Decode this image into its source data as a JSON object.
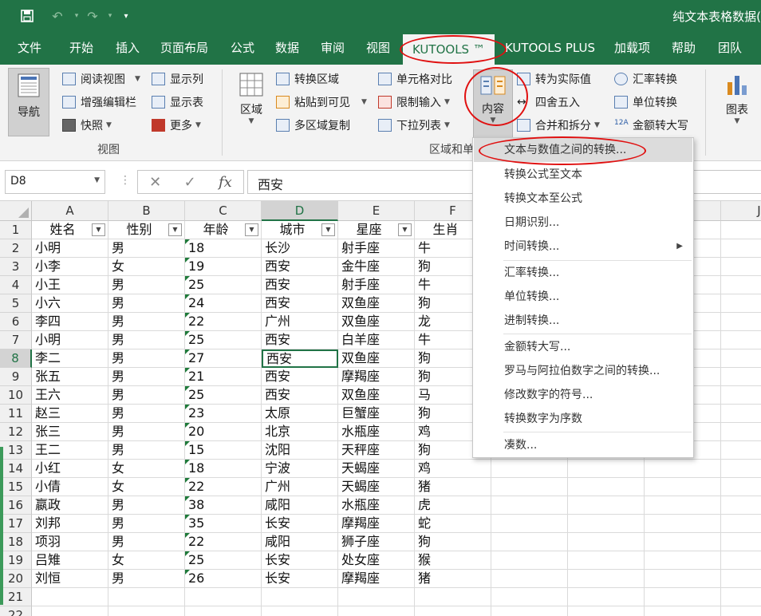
{
  "titlebar": {
    "doc_title": "纯文本表格数据(",
    "save_icon": "save-icon",
    "undo_icon": "undo-icon",
    "redo_icon": "redo-icon"
  },
  "tabs": [
    "文件",
    "开始",
    "插入",
    "页面布局",
    "公式",
    "数据",
    "审阅",
    "视图",
    "KUTOOLS ™",
    "KUTOOLS PLUS",
    "加载项",
    "帮助",
    "团队"
  ],
  "ribbon": {
    "nav": "导航",
    "reading_view": "阅读视图",
    "enhanced_edit": "增强编辑栏",
    "snapshot": "快照",
    "show_columns": "显示列",
    "show_sheets": "显示表",
    "more": "更多",
    "view_group": "视图",
    "range": "区域",
    "convert_range": "转换区域",
    "paste_visible": "粘贴到可见",
    "multi_copy": "多区域复制",
    "cell_compare": "单元格对比",
    "limit_input": "限制输入",
    "dropdown_list": "下拉列表",
    "range_group": "区域和单",
    "content": "内容",
    "to_actual": "转为实际值",
    "round": "四舍五入",
    "merge_split": "合并和拆分",
    "exchange_rate": "汇率转换",
    "unit_convert": "单位转换",
    "amount_upper": "金额转大写",
    "chart": "图表"
  },
  "formula_bar": {
    "name_box": "D8",
    "fx": "fx",
    "value": "西安"
  },
  "columns": [
    "A",
    "B",
    "C",
    "D",
    "E",
    "F",
    "",
    "",
    "",
    "J"
  ],
  "headers": [
    "姓名",
    "性别",
    "年龄",
    "城市",
    "星座",
    "生肖"
  ],
  "rows": [
    [
      "小明",
      "男",
      "18",
      "长沙",
      "射手座",
      "牛"
    ],
    [
      "小李",
      "女",
      "19",
      "西安",
      "金牛座",
      "狗"
    ],
    [
      "小王",
      "男",
      "25",
      "西安",
      "射手座",
      "牛"
    ],
    [
      "小六",
      "男",
      "24",
      "西安",
      "双鱼座",
      "狗"
    ],
    [
      "李四",
      "男",
      "22",
      "广州",
      "双鱼座",
      "龙"
    ],
    [
      "小明",
      "男",
      "25",
      "西安",
      "白羊座",
      "牛"
    ],
    [
      "李二",
      "男",
      "27",
      "西安",
      "双鱼座",
      "狗"
    ],
    [
      "张五",
      "男",
      "21",
      "西安",
      "摩羯座",
      "狗"
    ],
    [
      "王六",
      "男",
      "25",
      "西安",
      "双鱼座",
      "马"
    ],
    [
      "赵三",
      "男",
      "23",
      "太原",
      "巨蟹座",
      "狗"
    ],
    [
      "张三",
      "男",
      "20",
      "北京",
      "水瓶座",
      "鸡"
    ],
    [
      "王二",
      "男",
      "15",
      "沈阳",
      "天秤座",
      "狗"
    ],
    [
      "小红",
      "女",
      "18",
      "宁波",
      "天蝎座",
      "鸡"
    ],
    [
      "小倩",
      "女",
      "22",
      "广州",
      "天蝎座",
      "猪"
    ],
    [
      "嬴政",
      "男",
      "38",
      "咸阳",
      "水瓶座",
      "虎"
    ],
    [
      "刘邦",
      "男",
      "35",
      "长安",
      "摩羯座",
      "蛇"
    ],
    [
      "项羽",
      "男",
      "22",
      "咸阳",
      "狮子座",
      "狗"
    ],
    [
      "吕雉",
      "女",
      "25",
      "长安",
      "处女座",
      "猴"
    ],
    [
      "刘恒",
      "男",
      "26",
      "长安",
      "摩羯座",
      "猪"
    ]
  ],
  "row_numbers": [
    "1",
    "2",
    "3",
    "4",
    "5",
    "6",
    "7",
    "8",
    "9",
    "10",
    "11",
    "12",
    "13",
    "14",
    "15",
    "16",
    "17",
    "18",
    "19",
    "20",
    "21",
    "22"
  ],
  "menu": {
    "items": [
      "文本与数值之间的转换...",
      "转换公式至文本",
      "转换文本至公式",
      "日期识别...",
      "时间转换...",
      "汇率转换...",
      "单位转换...",
      "进制转换...",
      "金额转大写...",
      "罗马与阿拉伯数字之间的转换...",
      "修改数字的符号...",
      "转换数字为序数",
      "凑数..."
    ]
  }
}
